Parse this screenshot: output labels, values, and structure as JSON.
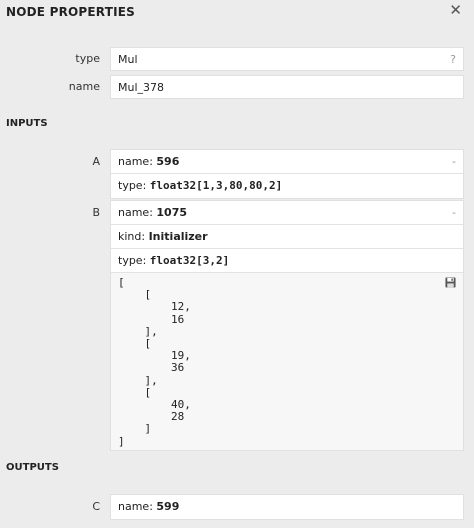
{
  "panel": {
    "title": "NODE PROPERTIES",
    "close": "✕"
  },
  "properties": {
    "type": {
      "label": "type",
      "value": "Mul",
      "help": "?"
    },
    "name": {
      "label": "name",
      "value": "Mul_378"
    }
  },
  "inputs": {
    "title": "INPUTS",
    "A": {
      "label": "A",
      "name_key": "name: ",
      "name": "596",
      "type_key": "type: ",
      "type": "float32[1,3,80,80,2]",
      "toggle": "-"
    },
    "B": {
      "label": "B",
      "name_key": "name: ",
      "name": "1075",
      "kind_key": "kind: ",
      "kind": "Initializer",
      "type_key": "type: ",
      "type": "float32[3,2]",
      "toggle": "-",
      "value": "[\n    [\n        12,\n        16\n    ],\n    [\n        19,\n        36\n    ],\n    [\n        40,\n        28\n    ]\n]"
    }
  },
  "outputs": {
    "title": "OUTPUTS",
    "C": {
      "label": "C",
      "name_key": "name: ",
      "name": "599"
    }
  },
  "icons": {
    "save": "save-icon",
    "close": "close-icon"
  }
}
